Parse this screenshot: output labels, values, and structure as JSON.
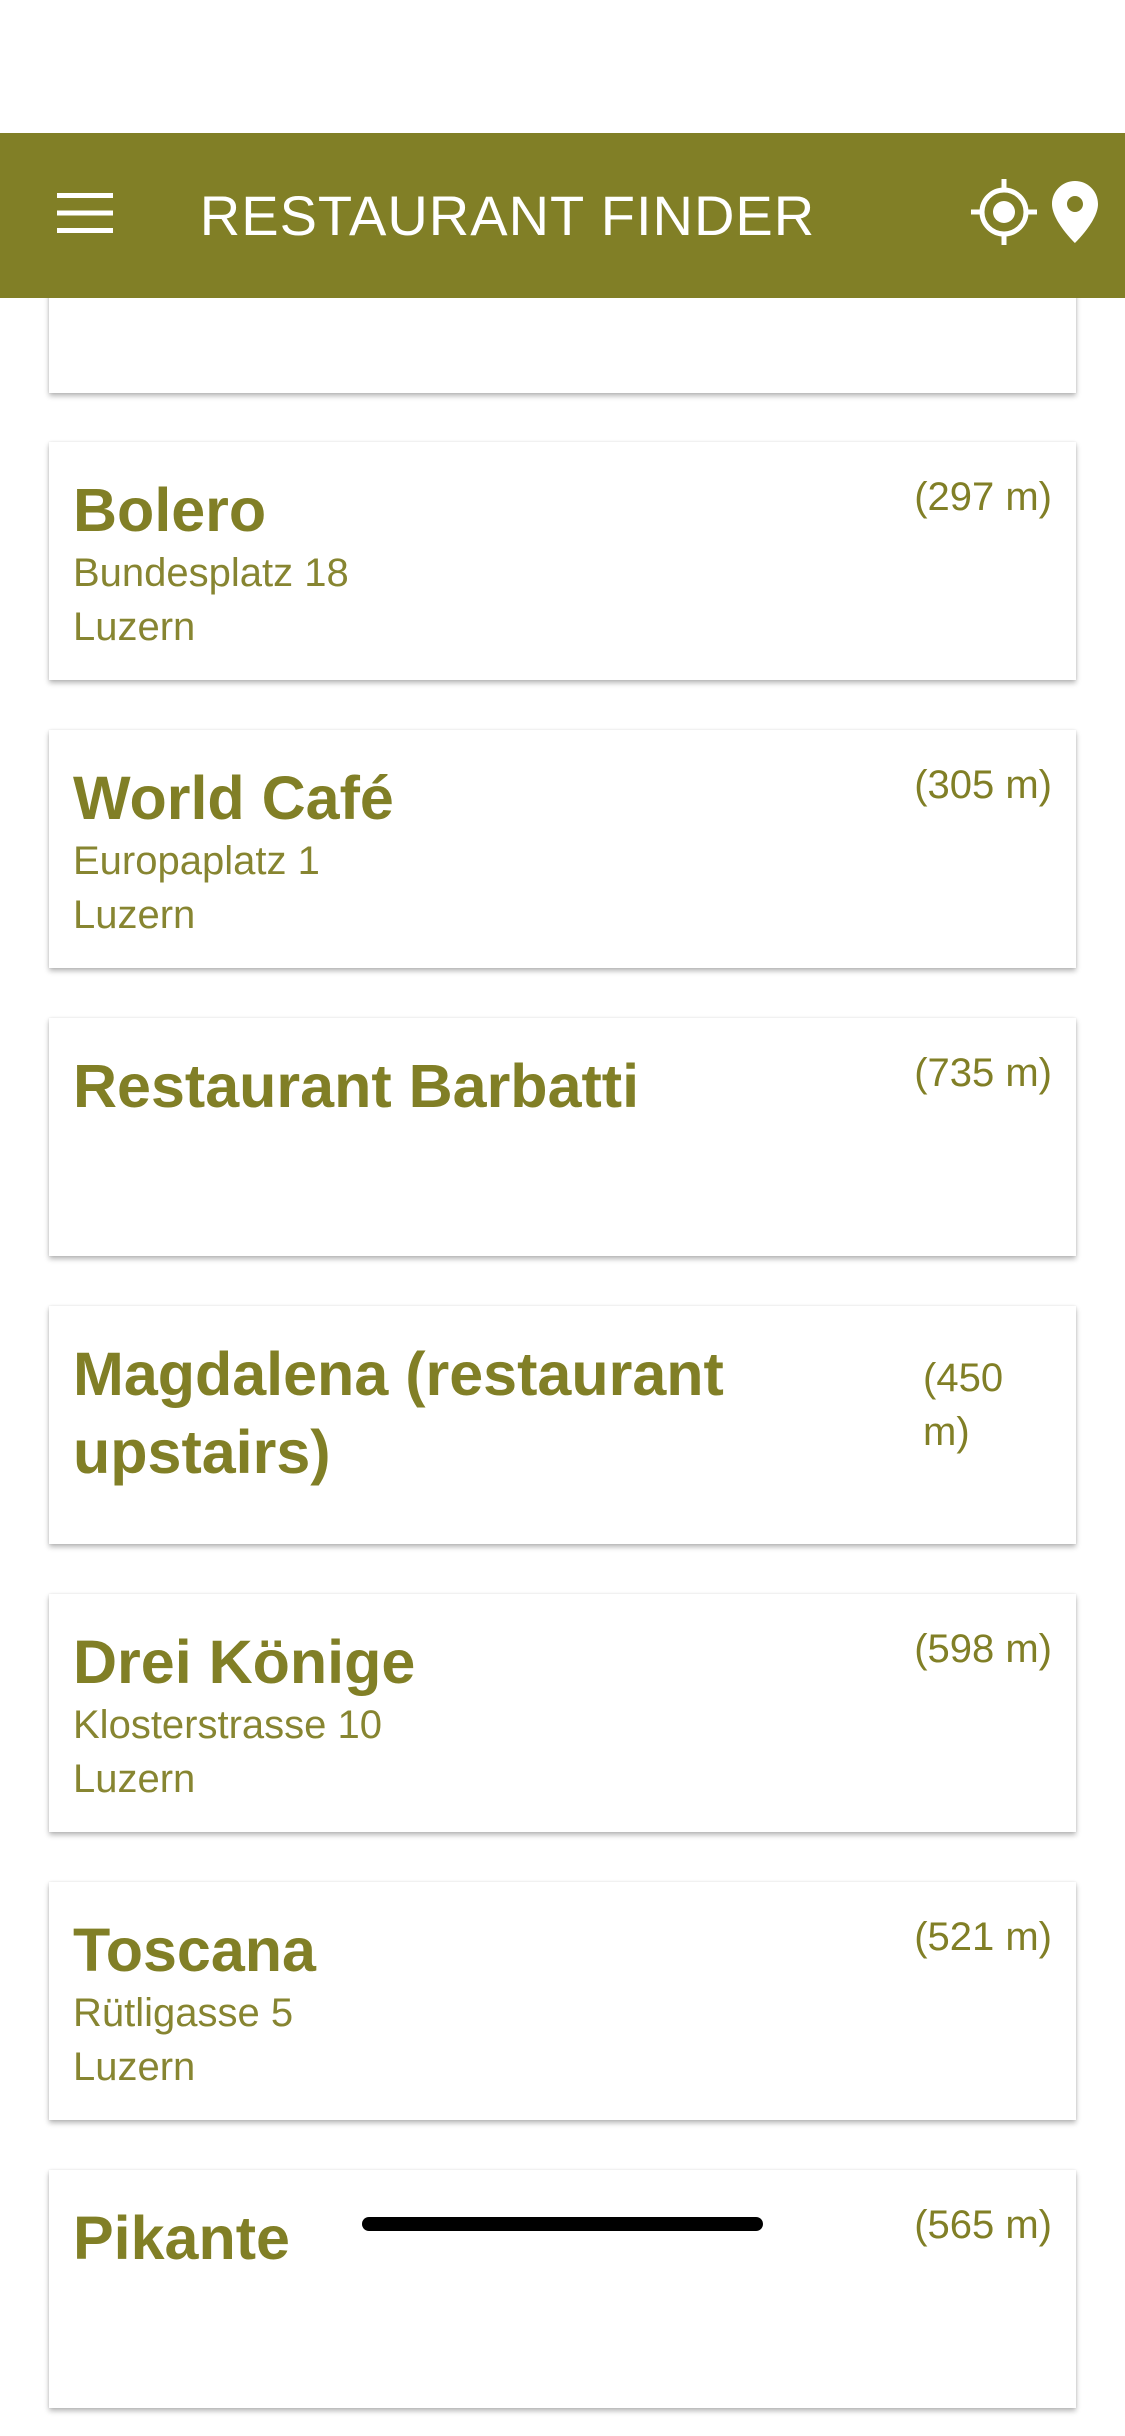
{
  "app_bar": {
    "title": "RESTAURANT FINDER",
    "menu_icon": "hamburger-menu-icon",
    "locate_icon": "gps-crosshair-icon",
    "map_icon": "map-pin-icon",
    "color": "#817f26"
  },
  "restaurants": [
    {
      "name": "",
      "distance": "",
      "address": "",
      "city": ""
    },
    {
      "name": "Bolero",
      "distance": "(297 m)",
      "address": "Bundesplatz 18",
      "city": "Luzern"
    },
    {
      "name": "World Café",
      "distance": "(305 m)",
      "address": "Europaplatz 1",
      "city": "Luzern"
    },
    {
      "name": "Restaurant Barbatti",
      "distance": "(735 m)",
      "address": "",
      "city": ""
    },
    {
      "name": "Magdalena (restaurant upstairs)",
      "distance": "(450 m)",
      "address": "",
      "city": ""
    },
    {
      "name": "Drei Könige",
      "distance": "(598 m)",
      "address": "Klosterstrasse 10",
      "city": "Luzern"
    },
    {
      "name": "Toscana",
      "distance": "(521 m)",
      "address": "Rütligasse 5",
      "city": "Luzern"
    },
    {
      "name": "Pikante",
      "distance": "(565 m)",
      "address": "",
      "city": ""
    }
  ]
}
